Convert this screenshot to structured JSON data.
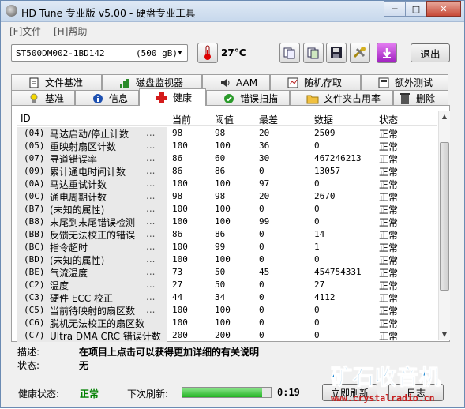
{
  "window": {
    "title": "HD Tune 专业版 v5.00 - 硬盘专业工具",
    "min": "─",
    "max": "□",
    "close": "✕"
  },
  "menu": [
    "[F]文件",
    "[H]帮助"
  ],
  "toolbar": {
    "drive_name": "ST500DM002-1BD142",
    "drive_size": "(500 gB)",
    "temperature": "27°C",
    "exit_label": "退出"
  },
  "tabs_top": [
    {
      "label": "文件基准",
      "icon": "file-benchmark-icon"
    },
    {
      "label": "磁盘监视器",
      "icon": "disk-monitor-icon"
    },
    {
      "label": "AAM",
      "icon": "speaker-icon"
    },
    {
      "label": "随机存取",
      "icon": "random-access-icon"
    },
    {
      "label": "额外测试",
      "icon": "extra-tests-icon"
    }
  ],
  "tabs_bottom": [
    {
      "label": "基准",
      "icon": "benchmark-icon"
    },
    {
      "label": "信息",
      "icon": "info-icon"
    },
    {
      "label": "健康",
      "icon": "health-cross-icon",
      "active": true
    },
    {
      "label": "错误扫描",
      "icon": "error-scan-icon"
    },
    {
      "label": "文件夹占用率",
      "icon": "folder-usage-icon"
    },
    {
      "label": "删除",
      "icon": "erase-icon"
    }
  ],
  "columns": [
    "ID",
    "当前",
    "阈值",
    "最差",
    "数据",
    "状态"
  ],
  "rows": [
    {
      "code": "(04)",
      "name": "马达启动/停止计数",
      "dots": "...",
      "current": "98",
      "threshold": "98",
      "worst": "20",
      "data": "2509",
      "status": "正常"
    },
    {
      "code": "(05)",
      "name": "重映射扇区计数",
      "dots": "...",
      "current": "100",
      "threshold": "100",
      "worst": "36",
      "data": "0",
      "status": "正常"
    },
    {
      "code": "(07)",
      "name": "寻道错误率",
      "dots": "...",
      "current": "86",
      "threshold": "60",
      "worst": "30",
      "data": "467246213",
      "status": "正常"
    },
    {
      "code": "(09)",
      "name": "累计通电时间计数",
      "dots": "...",
      "current": "86",
      "threshold": "86",
      "worst": "0",
      "data": "13057",
      "status": "正常"
    },
    {
      "code": "(0A)",
      "name": "马达重试计数",
      "dots": "...",
      "current": "100",
      "threshold": "100",
      "worst": "97",
      "data": "0",
      "status": "正常"
    },
    {
      "code": "(0C)",
      "name": "通电周期计数",
      "dots": "...",
      "current": "98",
      "threshold": "98",
      "worst": "20",
      "data": "2670",
      "status": "正常"
    },
    {
      "code": "(B7)",
      "name": "(未知的属性)",
      "dots": "...",
      "current": "100",
      "threshold": "100",
      "worst": "0",
      "data": "0",
      "status": "正常"
    },
    {
      "code": "(B8)",
      "name": "末尾到末尾错误检测",
      "dots": "...",
      "current": "100",
      "threshold": "100",
      "worst": "99",
      "data": "0",
      "status": "正常"
    },
    {
      "code": "(BB)",
      "name": "反馈无法校正的错误",
      "dots": "...",
      "current": "86",
      "threshold": "86",
      "worst": "0",
      "data": "14",
      "status": "正常"
    },
    {
      "code": "(BC)",
      "name": "指令超时",
      "dots": "...",
      "current": "100",
      "threshold": "99",
      "worst": "0",
      "data": "1",
      "status": "正常"
    },
    {
      "code": "(BD)",
      "name": "(未知的属性)",
      "dots": "...",
      "current": "100",
      "threshold": "100",
      "worst": "0",
      "data": "0",
      "status": "正常"
    },
    {
      "code": "(BE)",
      "name": "气流温度",
      "dots": "...",
      "current": "73",
      "threshold": "50",
      "worst": "45",
      "data": "454754331",
      "status": "正常"
    },
    {
      "code": "(C2)",
      "name": "温度",
      "dots": "...",
      "current": "27",
      "threshold": "50",
      "worst": "0",
      "data": "27",
      "status": "正常"
    },
    {
      "code": "(C3)",
      "name": "硬件 ECC 校正",
      "dots": "...",
      "current": "44",
      "threshold": "34",
      "worst": "0",
      "data": "4112",
      "status": "正常"
    },
    {
      "code": "(C5)",
      "name": "当前待映射的扇区数",
      "dots": "...",
      "current": "100",
      "threshold": "100",
      "worst": "0",
      "data": "0",
      "status": "正常"
    },
    {
      "code": "(C6)",
      "name": "脱机无法校正的扇区数",
      "dots": "",
      "current": "100",
      "threshold": "100",
      "worst": "0",
      "data": "0",
      "status": "正常"
    },
    {
      "code": "(C7)",
      "name": "Ultra DMA CRC 错误计数",
      "dots": "",
      "current": "200",
      "threshold": "200",
      "worst": "0",
      "data": "0",
      "status": "正常"
    }
  ],
  "description": {
    "desc_label": "描述:",
    "desc_value": "在项目上点击可以获得更加详细的有关说明",
    "status_label": "状态:",
    "status_value": "无"
  },
  "statusbar": {
    "health_label": "健康状态:",
    "health_value": "正常",
    "next_refresh_label": "下次刷新:",
    "refresh_progress_fraction": 0.9,
    "timer": "0:19",
    "refresh_now": "立即刷新",
    "log": "日志"
  },
  "watermark": {
    "text": "矿石收音机",
    "url": "www.crystalradio.cn"
  },
  "colors": {
    "health_ok": "#008000",
    "watermark_blue": "#0d7fcf",
    "watermark_red": "#c62020"
  }
}
